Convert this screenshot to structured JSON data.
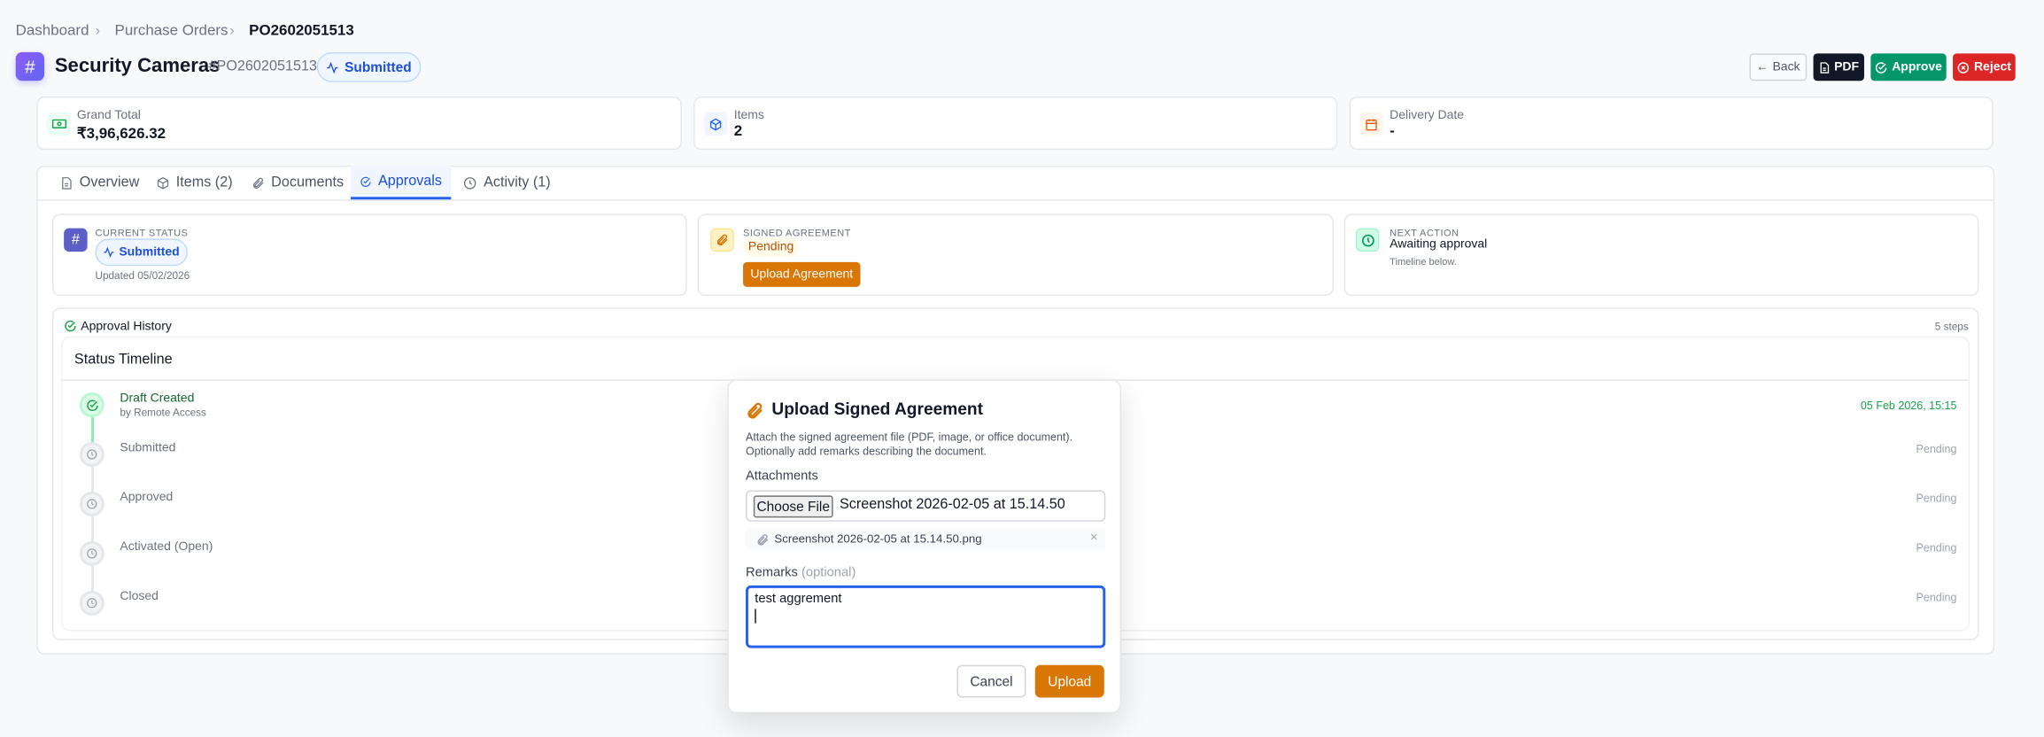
{
  "breadcrumb": {
    "items": [
      "Dashboard",
      "Purchase Orders"
    ],
    "current": "PO2602051513"
  },
  "header": {
    "title": "Security Cameras",
    "po_number": "#PO2602051513",
    "status": "Submitted",
    "actions": {
      "back": "Back",
      "pdf": "PDF",
      "approve": "Approve",
      "reject": "Reject"
    }
  },
  "stats": [
    {
      "label": "Grand Total",
      "value": "₹3,96,626.32",
      "icon": "banknote-icon"
    },
    {
      "label": "Items",
      "value": "2",
      "icon": "package-icon"
    },
    {
      "label": "Delivery Date",
      "value": "-",
      "icon": "calendar-icon"
    }
  ],
  "tabs": [
    {
      "label": "Overview"
    },
    {
      "label": "Items (2)"
    },
    {
      "label": "Documents"
    },
    {
      "label": "Approvals",
      "active": true
    },
    {
      "label": "Activity (1)"
    }
  ],
  "info": {
    "current_status": {
      "caption": "Current Status",
      "badge": "Submitted",
      "updated": "Updated 05/02/2026"
    },
    "signed_agreement": {
      "caption": "Signed Agreement",
      "status": "Pending",
      "button": "Upload Agreement"
    },
    "next_action": {
      "caption": "Next Action",
      "title": "Awaiting approval",
      "note": "Timeline below."
    }
  },
  "history": {
    "title": "Approval History",
    "count": "5 steps",
    "timeline_title": "Status Timeline",
    "steps": [
      {
        "label": "Draft Created",
        "by": "by Remote Access",
        "time": "05 Feb 2026, 15:15",
        "done": true
      },
      {
        "label": "Submitted",
        "time": "Pending"
      },
      {
        "label": "Approved",
        "time": "Pending"
      },
      {
        "label": "Activated (Open)",
        "time": "Pending"
      },
      {
        "label": "Closed",
        "time": "Pending"
      }
    ]
  },
  "modal": {
    "title": "Upload Signed Agreement",
    "description_1": "Attach the signed agreement file (PDF, image, or office document).",
    "description_2": "Optionally add remarks describing the document.",
    "attachments_label": "Attachments",
    "choose_file": "Choose File",
    "file_input_value": "Screenshot 2026-02-05 at 15.14.50",
    "attached_file": "Screenshot 2026-02-05 at 15.14.50.png",
    "remarks_label": "Remarks",
    "remarks_hint": "(optional)",
    "remarks_value": "test aggrement",
    "cancel": "Cancel",
    "upload": "Upload"
  },
  "colors": {
    "accent": "#2563eb",
    "orange": "#d97706",
    "approve": "#059669",
    "reject": "#dc2626",
    "dark": "#111827"
  }
}
